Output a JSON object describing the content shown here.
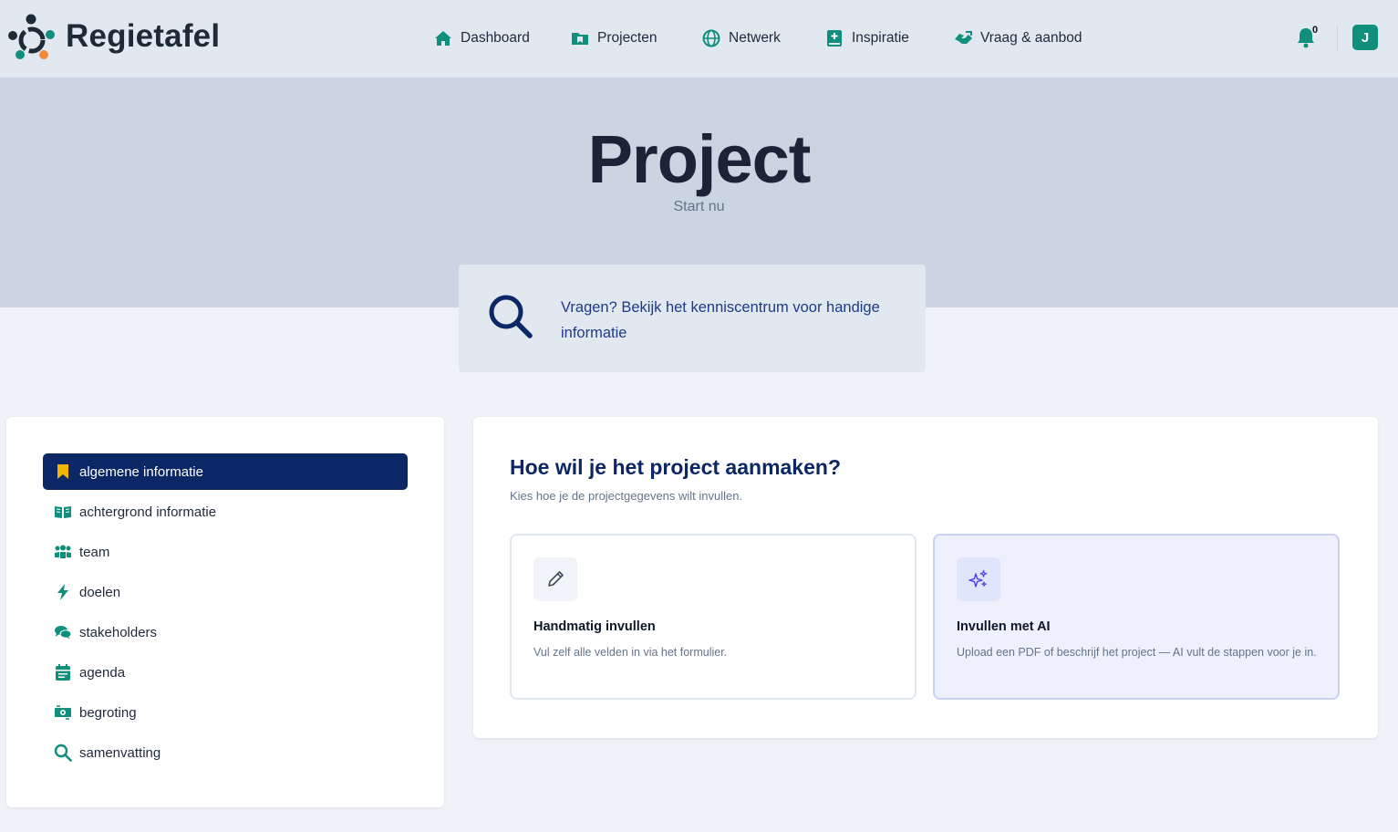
{
  "header": {
    "brand": "Regietafel",
    "nav": [
      {
        "label": "Dashboard",
        "icon": "home-icon"
      },
      {
        "label": "Projecten",
        "icon": "folder-icon"
      },
      {
        "label": "Netwerk",
        "icon": "globe-icon"
      },
      {
        "label": "Inspiratie",
        "icon": "book-plus-icon"
      },
      {
        "label": "Vraag & aanbod",
        "icon": "handshake-icon"
      }
    ],
    "notifications_count": "0",
    "avatar_initial": "J"
  },
  "hero": {
    "title": "Project",
    "subtitle": "Start nu"
  },
  "help": {
    "text": "Vragen? Bekijk het kenniscentrum voor handige informatie"
  },
  "steps": [
    {
      "label": "algemene informatie",
      "icon": "bookmark-icon",
      "active": true
    },
    {
      "label": "achtergrond informatie",
      "icon": "open-book-icon"
    },
    {
      "label": "team",
      "icon": "people-icon"
    },
    {
      "label": "doelen",
      "icon": "lightning-icon"
    },
    {
      "label": "stakeholders",
      "icon": "chat-bubbles-icon"
    },
    {
      "label": "agenda",
      "icon": "calendar-icon"
    },
    {
      "label": "begroting",
      "icon": "money-icon"
    },
    {
      "label": "samenvatting",
      "icon": "search-icon"
    }
  ],
  "create": {
    "title": "Hoe wil je het project aanmaken?",
    "subtitle": "Kies hoe je de projectgegevens wilt invullen.",
    "manual": {
      "title": "Handmatig invullen",
      "description": "Vul zelf alle velden in via het formulier."
    },
    "ai": {
      "title": "Invullen met AI",
      "description": "Upload een PDF of beschrijf het project — AI vult de stappen voor je in."
    }
  },
  "colors": {
    "primary_teal": "#0f8f7c",
    "navy": "#0c2766",
    "accent_yellow": "#f5b301",
    "ai_purple": "#4f46e5"
  }
}
